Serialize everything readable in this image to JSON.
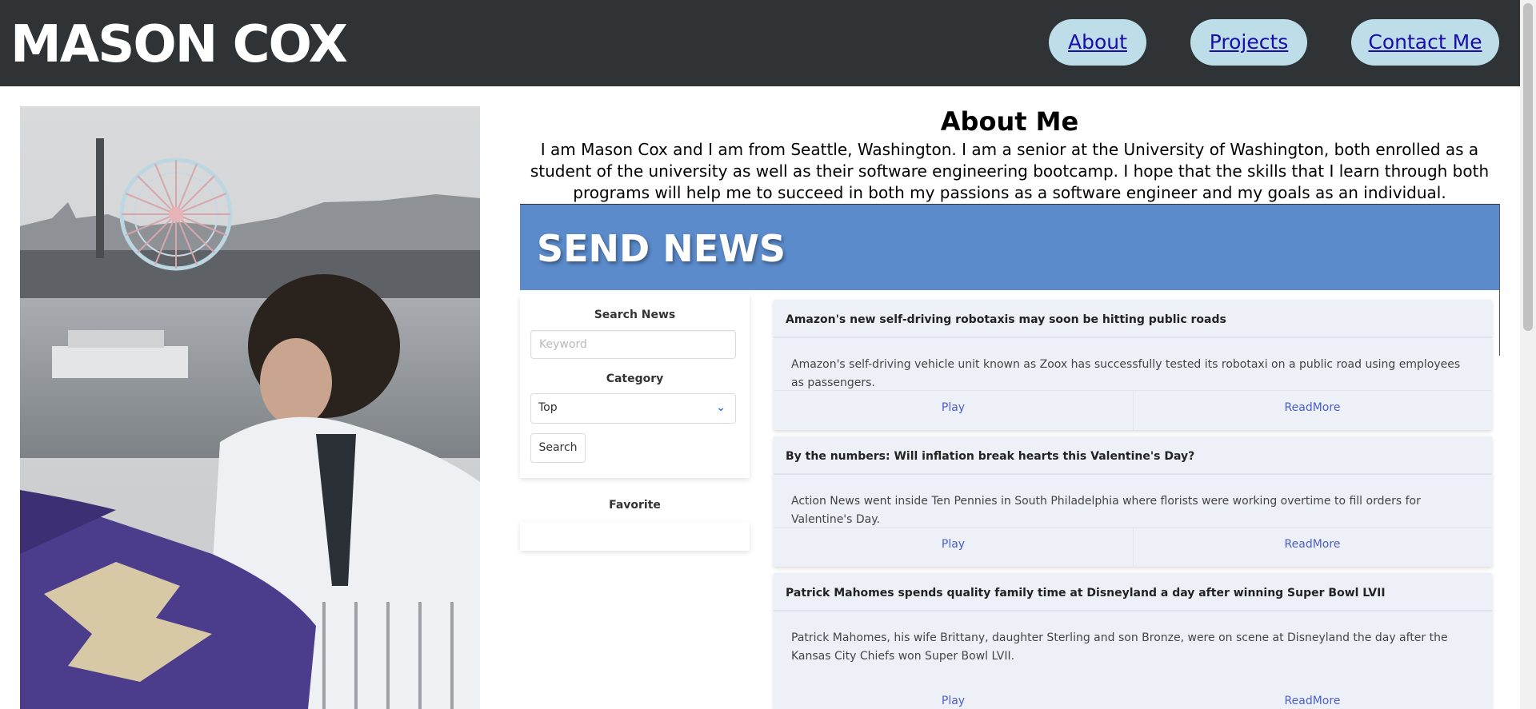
{
  "header": {
    "brand": "MASON COX",
    "nav": [
      {
        "label": "About"
      },
      {
        "label": "Projects"
      },
      {
        "label": "Contact Me"
      }
    ]
  },
  "about": {
    "title": "About Me",
    "text": "I am Mason Cox and I am from Seattle, Washington. I am a senior at the University of Washington, both enrolled as a student of the university as well as their software engineering bootcamp. I hope that the skills that I learn through both programs will help me to succeed in both my passions as a software engineer and my goals as an individual."
  },
  "app": {
    "title": "SEND NEWS",
    "search": {
      "label": "Search News",
      "placeholder": "Keyword",
      "category_label": "Category",
      "category_value": "Top",
      "button": "Search"
    },
    "favorite_label": "Favorite",
    "articles": [
      {
        "title": "Amazon's new self-driving robotaxis may soon be hitting public roads",
        "description": "Amazon's self-driving vehicle unit known as Zoox has successfully tested its robotaxi on a public road using employees as passengers.",
        "play": "Play",
        "read": "ReadMore"
      },
      {
        "title": "By the numbers: Will inflation break hearts this Valentine's Day?",
        "description": "Action News went inside Ten Pennies in South Philadelphia where florists were working overtime to fill orders for Valentine's Day.",
        "play": "Play",
        "read": "ReadMore"
      },
      {
        "title": "Patrick Mahomes spends quality family time at Disneyland a day after winning Super Bowl LVII",
        "description": "Patrick Mahomes, his wife Brittany, daughter Sterling and son Bronze, were on scene at Disneyland the day after the Kansas City Chiefs won Super Bowl LVII.",
        "play": "Play",
        "read": "ReadMore"
      }
    ]
  },
  "colors": {
    "header_bg": "#2f3336",
    "nav_pill": "#bddde8",
    "banner": "#5b8bcb",
    "card_bg": "#eef0f8",
    "link": "#485fc7"
  }
}
